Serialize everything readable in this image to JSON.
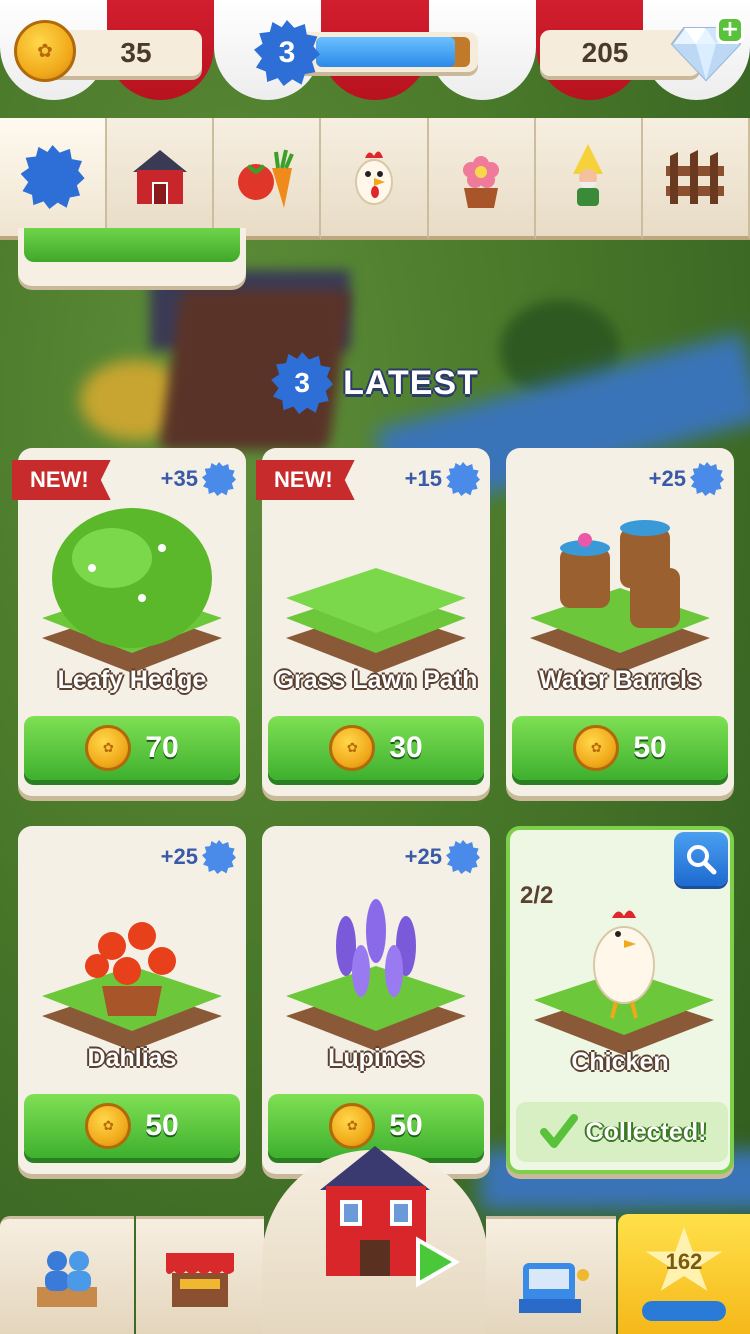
{
  "hud": {
    "coins": "35",
    "level": "3",
    "xp_progress": 0.9,
    "gems": "205"
  },
  "tabs": [
    {
      "name": "tab-level",
      "icon": "level-badge-icon",
      "active": true
    },
    {
      "name": "tab-buildings",
      "icon": "barn-icon",
      "active": false
    },
    {
      "name": "tab-crops",
      "icon": "vegetables-icon",
      "active": false
    },
    {
      "name": "tab-animals",
      "icon": "chicken-icon",
      "active": false
    },
    {
      "name": "tab-flowers",
      "icon": "flower-pot-icon",
      "active": false
    },
    {
      "name": "tab-decorations",
      "icon": "gnome-icon",
      "active": false
    },
    {
      "name": "tab-fences",
      "icon": "fence-icon",
      "active": false
    }
  ],
  "section": {
    "level": "3",
    "title": "LATEST"
  },
  "cards": [
    {
      "badge": "NEW!",
      "xp": "+35",
      "name": "Leafy Hedge",
      "price": "70",
      "art": "hedge"
    },
    {
      "badge": "NEW!",
      "xp": "+15",
      "name": "Grass Lawn Path",
      "price": "30",
      "art": "lawn"
    },
    {
      "badge": "",
      "xp": "+25",
      "name": "Water Barrels",
      "price": "50",
      "art": "barrels"
    },
    {
      "badge": "",
      "xp": "+25",
      "name": "Dahlias",
      "price": "50",
      "art": "dahlias"
    },
    {
      "badge": "",
      "xp": "+25",
      "name": "Lupines",
      "price": "50",
      "art": "lupines"
    },
    {
      "badge": "",
      "count": "2/2",
      "name": "Chicken",
      "status": "Collected!",
      "art": "chicken"
    }
  ],
  "bottom": {
    "star_count": "162"
  },
  "colors": {
    "awning_red": "#d21e2e",
    "buy_green": "#3eb02e",
    "level_blue": "#2d6fd6",
    "new_ribbon": "#c72b2b"
  }
}
